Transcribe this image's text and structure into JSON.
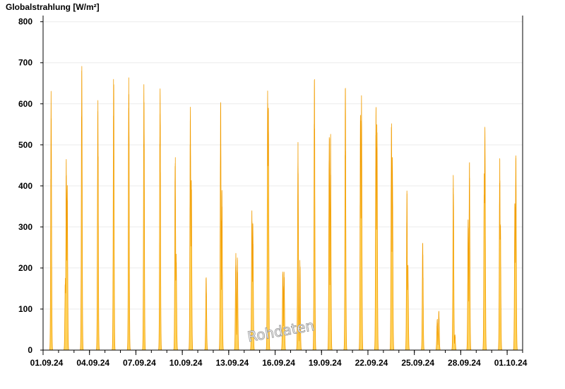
{
  "chart_data": {
    "type": "area",
    "title": "Globalstrahlung [W/m²]",
    "xlabel": "",
    "ylabel": "",
    "x_range": [
      "2024-09-01",
      "2024-10-02"
    ],
    "ylim": [
      0,
      815
    ],
    "y_ticks": [
      0,
      100,
      200,
      300,
      400,
      500,
      600,
      700,
      800
    ],
    "x_ticks": [
      "01.09.24",
      "04.09.24",
      "07.09.24",
      "10.09.24",
      "13.09.24",
      "16.09.24",
      "19.09.24",
      "22.09.24",
      "25.09.24",
      "28.09.24",
      "01.10.24"
    ],
    "grid": true,
    "watermark": "Rohdaten",
    "series": [
      {
        "fill_color": "#ffd25a",
        "line_color": "#f29d00",
        "daily": [
          {
            "date": "2024-09-01",
            "peaks": [
              {
                "t": 12.5,
                "v": 645
              }
            ]
          },
          {
            "date": "2024-09-02",
            "peaks": [
              {
                "t": 10.5,
                "v": 180
              },
              {
                "t": 12.0,
                "v": 470
              },
              {
                "t": 13.5,
                "v": 420
              }
            ]
          },
          {
            "date": "2024-09-03",
            "peaks": [
              {
                "t": 12.0,
                "v": 708
              }
            ]
          },
          {
            "date": "2024-09-04",
            "peaks": [
              {
                "t": 13.0,
                "v": 648
              }
            ]
          },
          {
            "date": "2024-09-05",
            "peaks": [
              {
                "t": 13.5,
                "v": 692
              }
            ]
          },
          {
            "date": "2024-09-06",
            "peaks": [
              {
                "t": 13.0,
                "v": 682
              }
            ]
          },
          {
            "date": "2024-09-07",
            "peaks": [
              {
                "t": 12.5,
                "v": 690
              }
            ]
          },
          {
            "date": "2024-09-08",
            "peaks": [
              {
                "t": 13.5,
                "v": 675
              }
            ]
          },
          {
            "date": "2024-09-09",
            "peaks": [
              {
                "t": 13.0,
                "v": 495
              },
              {
                "t": 14.5,
                "v": 240
              }
            ]
          },
          {
            "date": "2024-09-10",
            "peaks": [
              {
                "t": 12.5,
                "v": 620
              },
              {
                "t": 14.0,
                "v": 440
              }
            ]
          },
          {
            "date": "2024-09-11",
            "peaks": [
              {
                "t": 13.0,
                "v": 188
              }
            ]
          },
          {
            "date": "2024-09-12",
            "peaks": [
              {
                "t": 11.5,
                "v": 615
              },
              {
                "t": 13.5,
                "v": 390
              }
            ]
          },
          {
            "date": "2024-09-13",
            "peaks": [
              {
                "t": 11.0,
                "v": 248
              },
              {
                "t": 13.5,
                "v": 235
              }
            ]
          },
          {
            "date": "2024-09-14",
            "peaks": [
              {
                "t": 12.0,
                "v": 350
              },
              {
                "t": 13.5,
                "v": 320
              }
            ]
          },
          {
            "date": "2024-09-15",
            "peaks": [
              {
                "t": 12.5,
                "v": 660
              },
              {
                "t": 13.5,
                "v": 620
              }
            ]
          },
          {
            "date": "2024-09-16",
            "peaks": [
              {
                "t": 12.0,
                "v": 200
              },
              {
                "t": 14.0,
                "v": 195
              }
            ]
          },
          {
            "date": "2024-09-17",
            "peaks": [
              {
                "t": 11.5,
                "v": 525
              },
              {
                "t": 14.5,
                "v": 225
              }
            ]
          },
          {
            "date": "2024-09-18",
            "peaks": [
              {
                "t": 13.0,
                "v": 668
              }
            ]
          },
          {
            "date": "2024-09-19",
            "peaks": [
              {
                "t": 12.0,
                "v": 540
              },
              {
                "t": 14.0,
                "v": 545
              }
            ]
          },
          {
            "date": "2024-09-20",
            "peaks": [
              {
                "t": 13.0,
                "v": 650
              }
            ]
          },
          {
            "date": "2024-09-21",
            "peaks": [
              {
                "t": 12.5,
                "v": 628
              },
              {
                "t": 14.0,
                "v": 625
              }
            ]
          },
          {
            "date": "2024-09-22",
            "peaks": [
              {
                "t": 12.5,
                "v": 615
              },
              {
                "t": 14.0,
                "v": 560
              }
            ]
          },
          {
            "date": "2024-09-23",
            "peaks": [
              {
                "t": 12.5,
                "v": 583
              },
              {
                "t": 14.0,
                "v": 480
              }
            ]
          },
          {
            "date": "2024-09-24",
            "peaks": [
              {
                "t": 12.5,
                "v": 400
              },
              {
                "t": 14.0,
                "v": 220
              }
            ]
          },
          {
            "date": "2024-09-25",
            "peaks": [
              {
                "t": 13.0,
                "v": 275
              }
            ]
          },
          {
            "date": "2024-09-26",
            "peaks": [
              {
                "t": 11.5,
                "v": 82
              },
              {
                "t": 14.0,
                "v": 100
              }
            ]
          },
          {
            "date": "2024-09-27",
            "peaks": [
              {
                "t": 12.5,
                "v": 440
              },
              {
                "t": 15.0,
                "v": 40
              }
            ]
          },
          {
            "date": "2024-09-28",
            "peaks": [
              {
                "t": 11.5,
                "v": 340
              },
              {
                "t": 13.5,
                "v": 470
              }
            ]
          },
          {
            "date": "2024-09-29",
            "peaks": [
              {
                "t": 12.5,
                "v": 455
              },
              {
                "t": 13.5,
                "v": 572
              }
            ]
          },
          {
            "date": "2024-09-30",
            "peaks": [
              {
                "t": 12.5,
                "v": 475
              },
              {
                "t": 13.5,
                "v": 325
              }
            ]
          },
          {
            "date": "2024-10-01",
            "peaks": [
              {
                "t": 12.0,
                "v": 380
              },
              {
                "t": 13.5,
                "v": 497
              }
            ]
          }
        ]
      }
    ]
  }
}
